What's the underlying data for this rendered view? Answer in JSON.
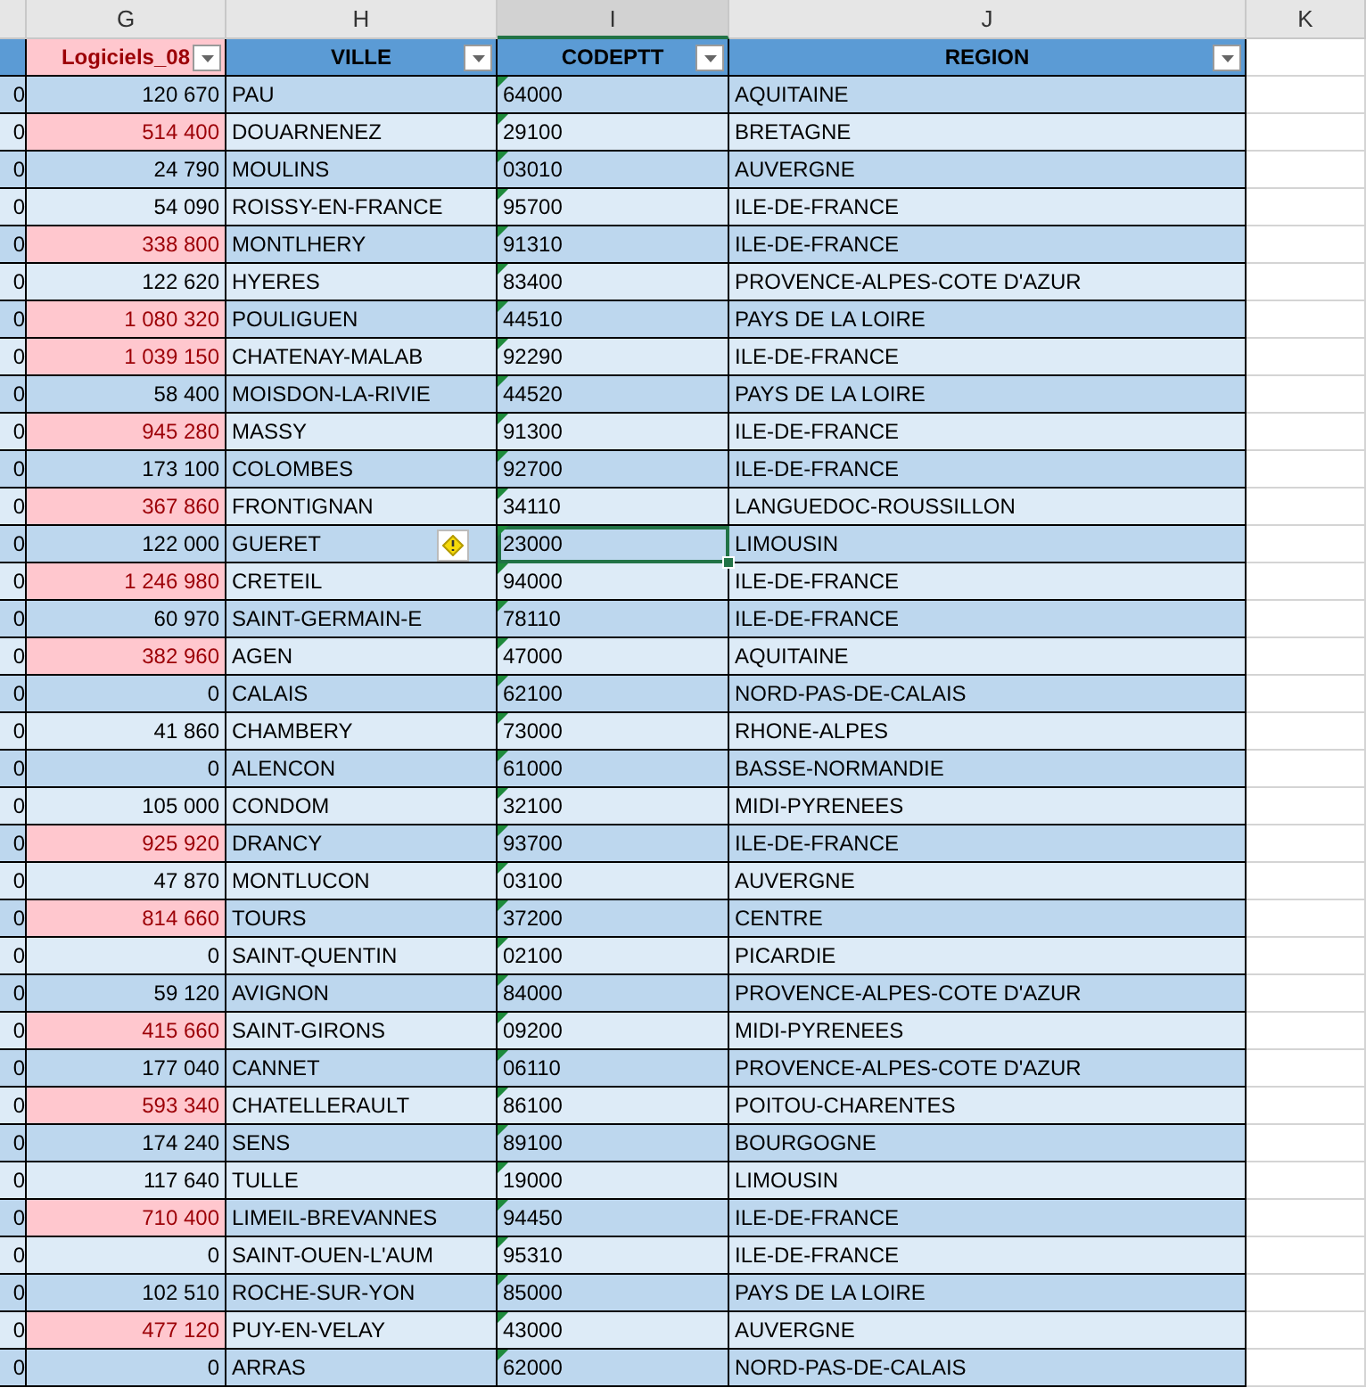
{
  "column_letters": [
    {
      "label": "G",
      "selected": false
    },
    {
      "label": "H",
      "selected": false
    },
    {
      "label": "I",
      "selected": true
    },
    {
      "label": "J",
      "selected": false
    },
    {
      "label": "K",
      "selected": false
    }
  ],
  "headers": [
    {
      "label": "Logiciels_08",
      "highlighted": true
    },
    {
      "label": "VILLE",
      "highlighted": false
    },
    {
      "label": "CODEPTT",
      "highlighted": false
    },
    {
      "label": "REGION",
      "highlighted": false
    }
  ],
  "rows": [
    {
      "f": "0",
      "g": "120 670",
      "ville": "PAU",
      "codeptt": "64000",
      "region": "AQUITAINE",
      "highlighted": false,
      "selected": false
    },
    {
      "f": "0",
      "g": "514 400",
      "ville": "DOUARNENEZ",
      "codeptt": "29100",
      "region": "BRETAGNE",
      "highlighted": true,
      "selected": false
    },
    {
      "f": "0",
      "g": "24 790",
      "ville": "MOULINS",
      "codeptt": "03010",
      "region": "AUVERGNE",
      "highlighted": false,
      "selected": false
    },
    {
      "f": "0",
      "g": "54 090",
      "ville": "ROISSY-EN-FRANCE",
      "codeptt": "95700",
      "region": "ILE-DE-FRANCE",
      "highlighted": false,
      "selected": false
    },
    {
      "f": "0",
      "g": "338 800",
      "ville": "MONTLHERY",
      "codeptt": "91310",
      "region": "ILE-DE-FRANCE",
      "highlighted": true,
      "selected": false
    },
    {
      "f": "0",
      "g": "122 620",
      "ville": "HYERES",
      "codeptt": "83400",
      "region": "PROVENCE-ALPES-COTE D'AZUR",
      "highlighted": false,
      "selected": false
    },
    {
      "f": "0",
      "g": "1 080 320",
      "ville": "POULIGUEN",
      "codeptt": "44510",
      "region": "PAYS DE LA LOIRE",
      "highlighted": true,
      "selected": false
    },
    {
      "f": "0",
      "g": "1 039 150",
      "ville": "CHATENAY-MALAB",
      "codeptt": "92290",
      "region": "ILE-DE-FRANCE",
      "highlighted": true,
      "selected": false
    },
    {
      "f": "0",
      "g": "58 400",
      "ville": "MOISDON-LA-RIVIE",
      "codeptt": "44520",
      "region": "PAYS DE LA LOIRE",
      "highlighted": false,
      "selected": false
    },
    {
      "f": "0",
      "g": "945 280",
      "ville": "MASSY",
      "codeptt": "91300",
      "region": "ILE-DE-FRANCE",
      "highlighted": true,
      "selected": false
    },
    {
      "f": "0",
      "g": "173 100",
      "ville": "COLOMBES",
      "codeptt": "92700",
      "region": "ILE-DE-FRANCE",
      "highlighted": false,
      "selected": false
    },
    {
      "f": "0",
      "g": "367 860",
      "ville": "FRONTIGNAN",
      "codeptt": "34110",
      "region": "LANGUEDOC-ROUSSILLON",
      "highlighted": true,
      "selected": false
    },
    {
      "f": "0",
      "g": "122 000",
      "ville": "GUERET",
      "codeptt": "23000",
      "region": "LIMOUSIN",
      "highlighted": false,
      "selected": true
    },
    {
      "f": "0",
      "g": "1 246 980",
      "ville": "CRETEIL",
      "codeptt": "94000",
      "region": "ILE-DE-FRANCE",
      "highlighted": true,
      "selected": false
    },
    {
      "f": "0",
      "g": "60 970",
      "ville": "SAINT-GERMAIN-E",
      "codeptt": "78110",
      "region": "ILE-DE-FRANCE",
      "highlighted": false,
      "selected": false
    },
    {
      "f": "0",
      "g": "382 960",
      "ville": "AGEN",
      "codeptt": "47000",
      "region": "AQUITAINE",
      "highlighted": true,
      "selected": false
    },
    {
      "f": "0",
      "g": "0",
      "ville": "CALAIS",
      "codeptt": "62100",
      "region": "NORD-PAS-DE-CALAIS",
      "highlighted": false,
      "selected": false
    },
    {
      "f": "0",
      "g": "41 860",
      "ville": "CHAMBERY",
      "codeptt": "73000",
      "region": "RHONE-ALPES",
      "highlighted": false,
      "selected": false
    },
    {
      "f": "0",
      "g": "0",
      "ville": "ALENCON",
      "codeptt": "61000",
      "region": "BASSE-NORMANDIE",
      "highlighted": false,
      "selected": false
    },
    {
      "f": "0",
      "g": "105 000",
      "ville": "CONDOM",
      "codeptt": "32100",
      "region": "MIDI-PYRENEES",
      "highlighted": false,
      "selected": false
    },
    {
      "f": "0",
      "g": "925 920",
      "ville": "DRANCY",
      "codeptt": "93700",
      "region": "ILE-DE-FRANCE",
      "highlighted": true,
      "selected": false
    },
    {
      "f": "0",
      "g": "47 870",
      "ville": "MONTLUCON",
      "codeptt": "03100",
      "region": "AUVERGNE",
      "highlighted": false,
      "selected": false
    },
    {
      "f": "0",
      "g": "814 660",
      "ville": "TOURS",
      "codeptt": "37200",
      "region": "CENTRE",
      "highlighted": true,
      "selected": false
    },
    {
      "f": "0",
      "g": "0",
      "ville": "SAINT-QUENTIN",
      "codeptt": "02100",
      "region": "PICARDIE",
      "highlighted": false,
      "selected": false
    },
    {
      "f": "0",
      "g": "59 120",
      "ville": "AVIGNON",
      "codeptt": "84000",
      "region": "PROVENCE-ALPES-COTE D'AZUR",
      "highlighted": false,
      "selected": false
    },
    {
      "f": "0",
      "g": "415 660",
      "ville": "SAINT-GIRONS",
      "codeptt": "09200",
      "region": "MIDI-PYRENEES",
      "highlighted": true,
      "selected": false
    },
    {
      "f": "0",
      "g": "177 040",
      "ville": "CANNET",
      "codeptt": "06110",
      "region": "PROVENCE-ALPES-COTE D'AZUR",
      "highlighted": false,
      "selected": false
    },
    {
      "f": "0",
      "g": "593 340",
      "ville": "CHATELLERAULT",
      "codeptt": "86100",
      "region": "POITOU-CHARENTES",
      "highlighted": true,
      "selected": false
    },
    {
      "f": "0",
      "g": "174 240",
      "ville": "SENS",
      "codeptt": "89100",
      "region": "BOURGOGNE",
      "highlighted": false,
      "selected": false
    },
    {
      "f": "0",
      "g": "117 640",
      "ville": "TULLE",
      "codeptt": "19000",
      "region": "LIMOUSIN",
      "highlighted": false,
      "selected": false
    },
    {
      "f": "0",
      "g": "710 400",
      "ville": "LIMEIL-BREVANNES",
      "codeptt": "94450",
      "region": "ILE-DE-FRANCE",
      "highlighted": true,
      "selected": false
    },
    {
      "f": "0",
      "g": "0",
      "ville": "SAINT-OUEN-L'AUM",
      "codeptt": "95310",
      "region": "ILE-DE-FRANCE",
      "highlighted": false,
      "selected": false
    },
    {
      "f": "0",
      "g": "102 510",
      "ville": "ROCHE-SUR-YON",
      "codeptt": "85000",
      "region": "PAYS DE LA LOIRE",
      "highlighted": false,
      "selected": false
    },
    {
      "f": "0",
      "g": "477 120",
      "ville": "PUY-EN-VELAY",
      "codeptt": "43000",
      "region": "AUVERGNE",
      "highlighted": true,
      "selected": false
    },
    {
      "f": "0",
      "g": "0",
      "ville": "ARRAS",
      "codeptt": "62000",
      "region": "NORD-PAS-DE-CALAIS",
      "highlighted": false,
      "selected": false
    }
  ]
}
